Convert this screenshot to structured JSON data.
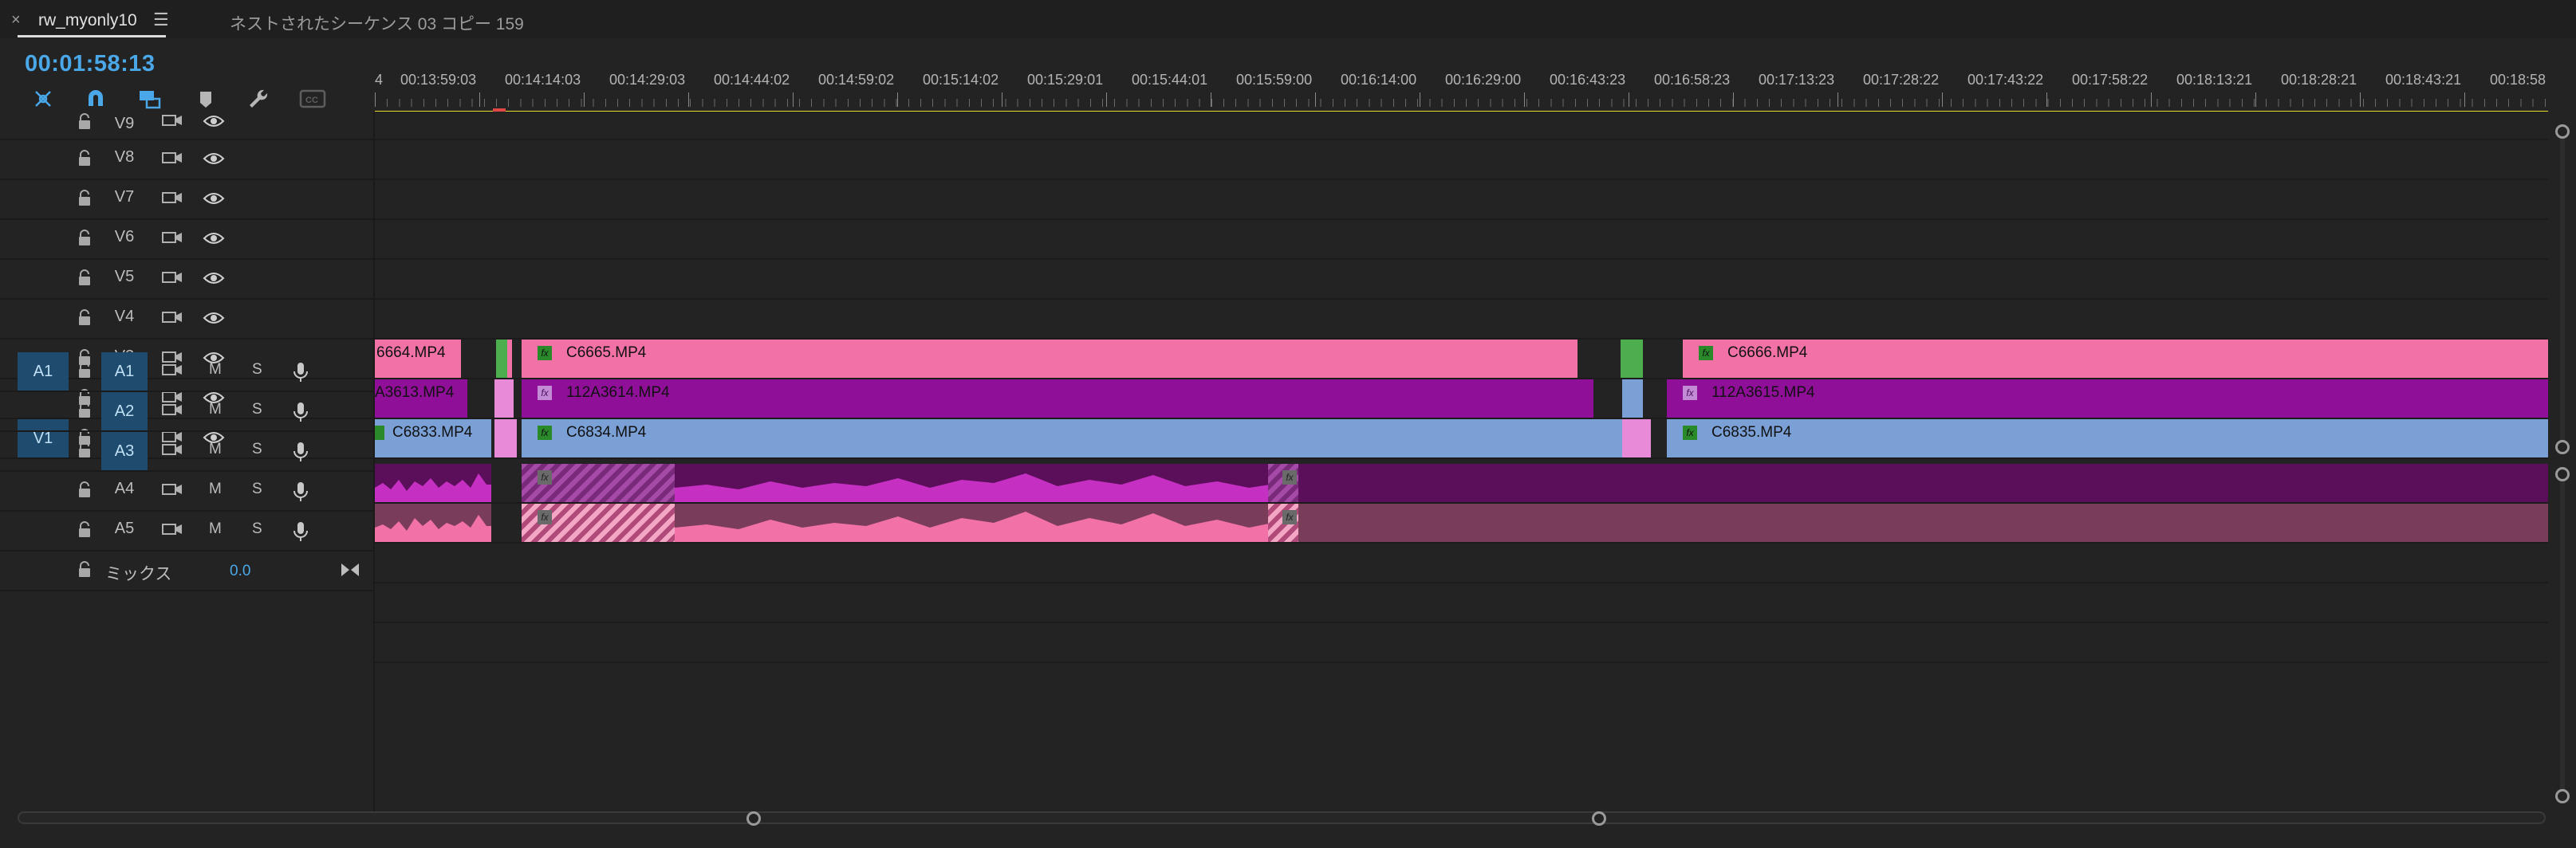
{
  "panel": {
    "tab_title": "rw_myonly10",
    "close_glyph": "×",
    "menu_glyph": "☰",
    "sequence_tab": "ネストされたシーケンス 03 コピー 159"
  },
  "playhead_timecode": "00:01:58:13",
  "ruler": {
    "first_fragment": "4",
    "ticks": [
      "00:13:59:03",
      "00:14:14:03",
      "00:14:29:03",
      "00:14:44:02",
      "00:14:59:02",
      "00:15:14:02",
      "00:15:29:01",
      "00:15:44:01",
      "00:15:59:00",
      "00:16:14:00",
      "00:16:29:00",
      "00:16:43:23",
      "00:16:58:23",
      "00:17:13:23",
      "00:17:28:22",
      "00:17:43:22",
      "00:17:58:22",
      "00:18:13:21",
      "00:18:28:21",
      "00:18:43:21",
      "00:18:58"
    ]
  },
  "video_tracks": [
    "V9",
    "V8",
    "V7",
    "V6",
    "V5",
    "V4",
    "V3",
    "V2",
    "V1"
  ],
  "audio_tracks": [
    "A1",
    "A2",
    "A3",
    "A4",
    "A5"
  ],
  "source_patch": {
    "video": "V1",
    "audio": "A1"
  },
  "audio_buttons": {
    "mute": "M",
    "solo": "S"
  },
  "mix": {
    "label": "ミックス",
    "value": "0.0"
  },
  "clips": {
    "v3": [
      "6664.MP4",
      "C6665.MP4",
      "C6666.MP4"
    ],
    "v2": [
      "A3613.MP4",
      "112A3614.MP4",
      "112A3615.MP4"
    ],
    "v1": [
      "C6833.MP4",
      "C6834.MP4",
      "C6835.MP4"
    ],
    "fx_badge": "fx"
  },
  "colors": {
    "accent": "#4aa7e8",
    "v3_clip": "#f271a6",
    "v2_clip": "#8f0f98",
    "v1_clip": "#7aa0d6",
    "a1_clip": "#5b0e5a",
    "a2_clip": "#7a3d59",
    "work_area": "#e8d92a"
  },
  "icons": [
    "snap-icon",
    "magnet-icon",
    "linked-selection-icon",
    "marker-icon",
    "wrench-icon",
    "captions-icon",
    "lock-icon",
    "toggle-sync-icon",
    "eye-icon",
    "mic-icon",
    "mix-rolloff-icon"
  ]
}
